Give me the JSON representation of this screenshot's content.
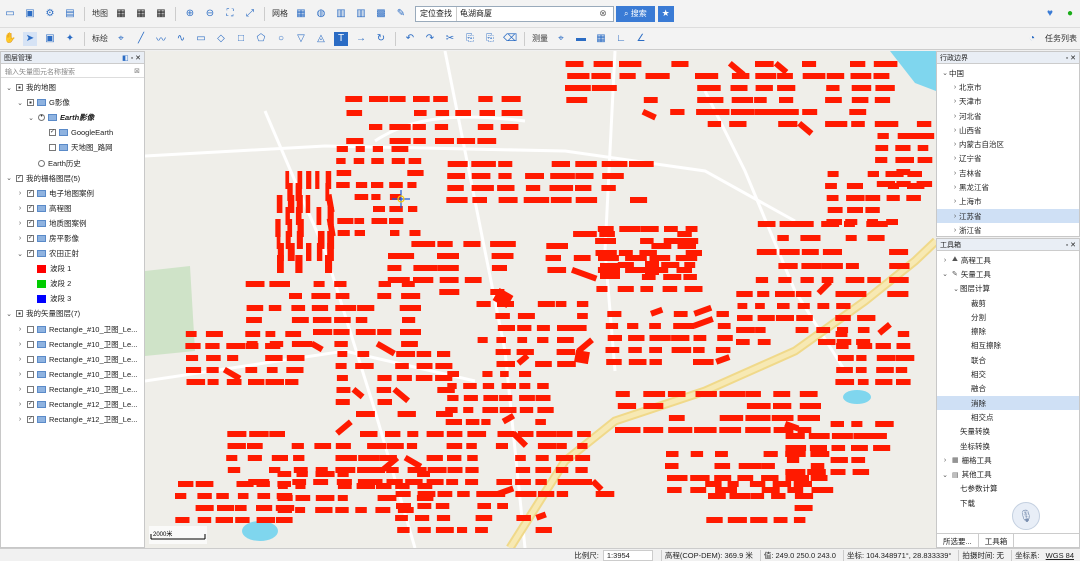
{
  "toolbar": {
    "map_label": "地图",
    "grid_label": "网格",
    "search_type": "定位查找",
    "search_value": "龟湖商厦",
    "search_button": "搜索",
    "annotate_label": "标绘",
    "measure_label": "测量",
    "task_list": "任务列表"
  },
  "layer_panel": {
    "title": "图层管理",
    "filter_placeholder": "输入矢量图元名称搜索",
    "items": [
      {
        "label": "我的地图",
        "level": 0,
        "arrow": "v",
        "check": "◼"
      },
      {
        "label": "G影像",
        "level": 1,
        "arrow": "v",
        "check": "◼"
      },
      {
        "label": "Earth影像",
        "level": 2,
        "arrow": "v",
        "check": "◉",
        "italic": true
      },
      {
        "label": "GoogleEarth",
        "level": 3,
        "arrow": "",
        "check": "✓"
      },
      {
        "label": "天地图_路网",
        "level": 3,
        "arrow": "",
        "check": ""
      },
      {
        "label": "Earth历史",
        "level": 2,
        "arrow": "",
        "check": "○"
      },
      {
        "label": "我的栅格图层(5)",
        "level": 0,
        "arrow": "v",
        "check": "✓"
      },
      {
        "label": "电子地图案例",
        "level": 1,
        "arrow": ">",
        "check": "✓"
      },
      {
        "label": "高程图",
        "level": 1,
        "arrow": ">",
        "check": "✓"
      },
      {
        "label": "地质图案例",
        "level": 1,
        "arrow": ">",
        "check": "✓"
      },
      {
        "label": "房平影像",
        "level": 1,
        "arrow": ">",
        "check": "✓"
      },
      {
        "label": "农田正射",
        "level": 1,
        "arrow": "v",
        "check": "✓"
      },
      {
        "label": "波段 1",
        "level": 2,
        "arrow": "",
        "swatch": "#ff0000"
      },
      {
        "label": "波段 2",
        "level": 2,
        "arrow": "",
        "swatch": "#00cc00"
      },
      {
        "label": "波段 3",
        "level": 2,
        "arrow": "",
        "swatch": "#0000ff"
      },
      {
        "label": "我的矢量图层(7)",
        "level": 0,
        "arrow": "v",
        "check": "◼"
      },
      {
        "label": "Rectangle_#10_卫图_Le...",
        "level": 1,
        "arrow": ">",
        "check": ""
      },
      {
        "label": "Rectangle_#10_卫图_Le...",
        "level": 1,
        "arrow": ">",
        "check": ""
      },
      {
        "label": "Rectangle_#10_卫图_Le...",
        "level": 1,
        "arrow": ">",
        "check": ""
      },
      {
        "label": "Rectangle_#10_卫图_Le...",
        "level": 1,
        "arrow": ">",
        "check": ""
      },
      {
        "label": "Rectangle_#10_卫图_Le...",
        "level": 1,
        "arrow": ">",
        "check": ""
      },
      {
        "label": "Rectangle_#12_卫图_Le...",
        "level": 1,
        "arrow": ">",
        "check": "✓"
      },
      {
        "label": "Rectangle_#12_卫图_Le...",
        "level": 1,
        "arrow": ">",
        "check": "✓"
      }
    ]
  },
  "admin_panel": {
    "title": "行政边界",
    "items": [
      {
        "label": "中国",
        "level": 0,
        "arrow": "v"
      },
      {
        "label": "北京市",
        "level": 1,
        "arrow": ">"
      },
      {
        "label": "天津市",
        "level": 1,
        "arrow": ">"
      },
      {
        "label": "河北省",
        "level": 1,
        "arrow": ">"
      },
      {
        "label": "山西省",
        "level": 1,
        "arrow": ">"
      },
      {
        "label": "内蒙古自治区",
        "level": 1,
        "arrow": ">"
      },
      {
        "label": "辽宁省",
        "level": 1,
        "arrow": ">"
      },
      {
        "label": "吉林省",
        "level": 1,
        "arrow": ">"
      },
      {
        "label": "黑龙江省",
        "level": 1,
        "arrow": ">"
      },
      {
        "label": "上海市",
        "level": 1,
        "arrow": ">"
      },
      {
        "label": "江苏省",
        "level": 1,
        "arrow": ">",
        "selected": true
      },
      {
        "label": "浙江省",
        "level": 1,
        "arrow": ">"
      }
    ]
  },
  "toolbox_panel": {
    "title": "工具箱",
    "items": [
      {
        "label": "高程工具",
        "level": 0,
        "arrow": ">"
      },
      {
        "label": "矢量工具",
        "level": 0,
        "arrow": "v"
      },
      {
        "label": "图层计算",
        "level": 1,
        "arrow": "v"
      },
      {
        "label": "裁剪",
        "level": 2,
        "arrow": ""
      },
      {
        "label": "分割",
        "level": 2,
        "arrow": ""
      },
      {
        "label": "擦除",
        "level": 2,
        "arrow": ""
      },
      {
        "label": "相互擦除",
        "level": 2,
        "arrow": ""
      },
      {
        "label": "联合",
        "level": 2,
        "arrow": ""
      },
      {
        "label": "相交",
        "level": 2,
        "arrow": ""
      },
      {
        "label": "融合",
        "level": 2,
        "arrow": ""
      },
      {
        "label": "消除",
        "level": 2,
        "arrow": "",
        "selected": true
      },
      {
        "label": "相交点",
        "level": 2,
        "arrow": ""
      },
      {
        "label": "矢量转换",
        "level": 1,
        "arrow": ""
      },
      {
        "label": "坐标转换",
        "level": 1,
        "arrow": ""
      },
      {
        "label": "栅格工具",
        "level": 0,
        "arrow": ">"
      },
      {
        "label": "其他工具",
        "level": 0,
        "arrow": "v"
      },
      {
        "label": "七参数计算",
        "level": 1,
        "arrow": ""
      },
      {
        "label": "下载",
        "level": 1,
        "arrow": ""
      }
    ],
    "tabs": [
      "所选要...",
      "工具箱"
    ]
  },
  "map": {
    "scale_text": "2000米"
  },
  "status": {
    "scale_label": "比例尺:",
    "scale_value": "1:3954",
    "elev": "高程(COP-DEM): 369.9 米",
    "value": "值: 249.0 250.0 243.0",
    "coords": "坐标: 104.348971°, 28.833339°",
    "capture": "拍摄时间: 无",
    "crs_label": "坐标系:",
    "crs_value": "WGS 84"
  },
  "colors": {
    "building": "#ff1a00",
    "road": "#f3de92",
    "water": "#7fd6ee",
    "accent": "#3a7bd5"
  }
}
